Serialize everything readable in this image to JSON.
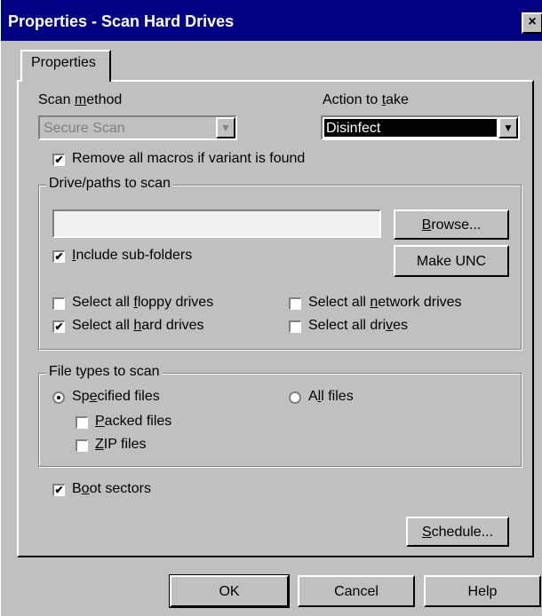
{
  "window": {
    "title": "Properties - Scan Hard Drives",
    "close_glyph": "×"
  },
  "tab": {
    "label": "Properties"
  },
  "scan_method": {
    "label_before": "Scan ",
    "label_mnemonic": "m",
    "label_after": "ethod",
    "value": "Secure Scan"
  },
  "action": {
    "label_before": "Action to ",
    "label_mnemonic": "t",
    "label_after": "ake",
    "value": "Disinfect"
  },
  "remove_macros": {
    "label": "Remove all macros if variant is found",
    "checked": true
  },
  "drives_group": {
    "legend": "Drive/paths to scan",
    "path_value": "",
    "browse_before": "",
    "browse_mnemonic": "B",
    "browse_after": "rowse...",
    "make_unc_label": "Make UNC",
    "include_sub": {
      "before": "",
      "mnemonic": "I",
      "after": "nclude sub-folders",
      "checked": true
    },
    "floppy": {
      "before": "Select all ",
      "mnemonic": "f",
      "after": "loppy drives",
      "checked": false
    },
    "network": {
      "before": "Select all ",
      "mnemonic": "n",
      "after": "etwork drives",
      "checked": false
    },
    "hard": {
      "before": "Select all ",
      "mnemonic": "h",
      "after": "ard drives",
      "checked": true
    },
    "all": {
      "before": "Select all dri",
      "mnemonic": "v",
      "after": "es",
      "checked": false
    }
  },
  "filetypes_group": {
    "legend": "File types to scan",
    "specified": {
      "before": "Sp",
      "mnemonic": "e",
      "after": "cified files",
      "selected": true
    },
    "all_files": {
      "before": "A",
      "mnemonic": "l",
      "after": "l files",
      "selected": false
    },
    "packed": {
      "before": "",
      "mnemonic": "P",
      "after": "acked files",
      "checked": false
    },
    "zip": {
      "before": "",
      "mnemonic": "Z",
      "after": "IP files",
      "checked": false
    }
  },
  "boot": {
    "before": "B",
    "mnemonic": "o",
    "after": "ot sectors",
    "checked": true
  },
  "schedule": {
    "before": "",
    "mnemonic": "S",
    "after": "chedule..."
  },
  "footer": {
    "ok": "OK",
    "cancel": "Cancel",
    "help": "Help"
  },
  "glyphs": {
    "check": "✔",
    "arrow": "▼"
  },
  "colors": {
    "face": "#c0c0c0",
    "title_bar": "#000080",
    "shadow": "#808080",
    "highlight": "#ffffff"
  },
  "icons": {
    "close": "close-icon",
    "dropdown": "chevron-down-icon"
  }
}
